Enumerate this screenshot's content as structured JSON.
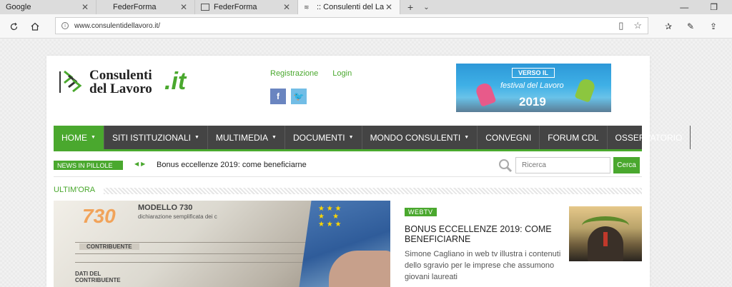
{
  "browser": {
    "tabs": [
      {
        "title": "Google",
        "active": false
      },
      {
        "title": "FederForma",
        "active": false
      },
      {
        "title": "FederForma",
        "active": false
      },
      {
        "title": ":: Consulenti del Lavoro",
        "active": true
      }
    ],
    "url": "www.consulentidellavoro.it/"
  },
  "header": {
    "logo_line1": "Consulenti",
    "logo_line2": "del Lavoro",
    "logo_suffix": ".it",
    "registrazione": "Registrazione",
    "login": "Login",
    "banner_top": "VERSO IL",
    "banner_mid": "festival del Lavoro",
    "banner_year": "2019"
  },
  "menu": {
    "items": [
      {
        "label": "HOME",
        "dropdown": true,
        "active": true
      },
      {
        "label": "SITI ISTITUZIONALI",
        "dropdown": true
      },
      {
        "label": "MULTIMEDIA",
        "dropdown": true
      },
      {
        "label": "DOCUMENTI",
        "dropdown": true
      },
      {
        "label": "MONDO CONSULENTI",
        "dropdown": true
      },
      {
        "label": "CONVEGNI",
        "dropdown": false
      },
      {
        "label": "FORUM CDL",
        "dropdown": false
      },
      {
        "label": "OSSERVATORIO",
        "dropdown": false
      }
    ]
  },
  "news": {
    "label": "NEWS IN PILLOLE",
    "text": "Bonus eccellenze 2019: come beneficiarne",
    "search_placeholder": "Ricerca",
    "search_button": "Cerca"
  },
  "ultimora": {
    "label": "ULTIM'ORA"
  },
  "featured": {
    "form_number": "730",
    "form_title": "MODELLO 730",
    "form_subtitle": "dichiarazione semplificata dei c",
    "form_contribuente": "CONTRIBUENTE",
    "form_dati": "DATI DEL\nCONTRIBUENTE"
  },
  "article": {
    "badge": "WEBTV",
    "title": "BONUS ECCELLENZE 2019: COME BENEFICIARNE",
    "desc": "Simone Cagliano in web tv illustra i contenuti dello sgravio per le imprese che assumono giovani laureati"
  },
  "colors": {
    "accent": "#4aa82e",
    "menu_bg": "#444444"
  }
}
